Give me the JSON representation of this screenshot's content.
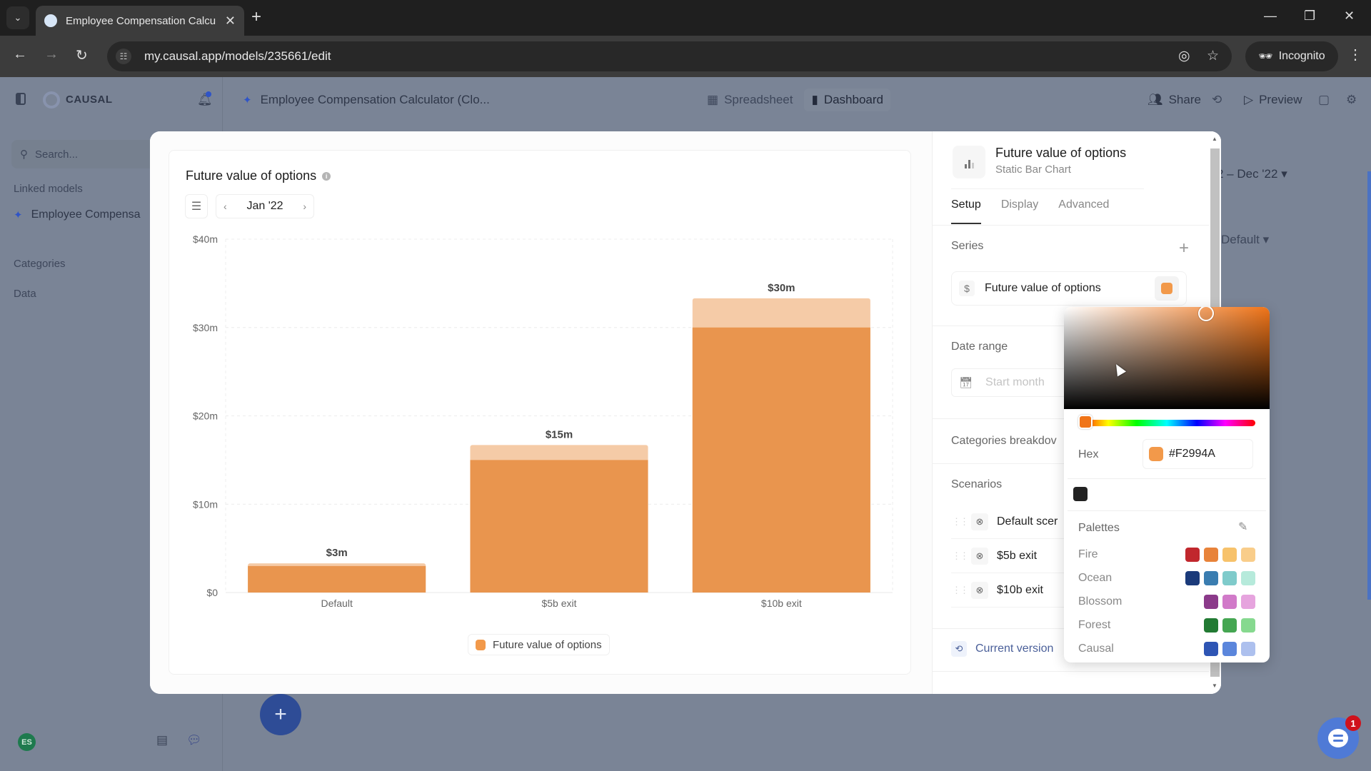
{
  "browser": {
    "tab_title": "Employee Compensation Calcu",
    "url": "my.causal.app/models/235661/edit",
    "profile_label": "Incognito"
  },
  "app": {
    "brand": "CAUSAL",
    "doc_title": "Employee Compensation Calculator (Clo...",
    "view_tabs": [
      {
        "label": "Spreadsheet",
        "active": false
      },
      {
        "label": "Dashboard",
        "active": true
      }
    ],
    "share_label": "Share",
    "preview_label": "Preview",
    "sidebar": {
      "search_placeholder": "Search...",
      "linked_models_label": "Linked models",
      "linked_model": "Employee Compensa",
      "categories_label": "Categories",
      "data_label": "Data",
      "avatar_initials": "ES"
    },
    "background": {
      "date_range": "2 – Dec '22",
      "scenario_select": "Default"
    },
    "chat_badge_count": "1"
  },
  "chart_widget": {
    "title": "Future value of options",
    "date_label": "Jan '22",
    "legend_label": "Future value of options"
  },
  "chart_data": {
    "type": "bar",
    "title": "Future value of options",
    "categories": [
      "Default",
      "$5b exit",
      "$10b exit"
    ],
    "series": [
      {
        "name": "Future value of options",
        "values": [
          3.3,
          16.7,
          33.3
        ],
        "color": "#F2994A"
      }
    ],
    "data_labels": [
      "$3m",
      "$15m",
      "$30m"
    ],
    "highlight_base_values": [
      3,
      15,
      30
    ],
    "ylim": [
      0,
      40
    ],
    "yticks": [
      0,
      10,
      20,
      30,
      40
    ],
    "ytick_labels": [
      "$0",
      "$10m",
      "$20m",
      "$30m",
      "$40m"
    ],
    "xlabel": "",
    "ylabel": "",
    "grid": true,
    "legend": "bottom-center"
  },
  "panel": {
    "title": "Future value of options",
    "subtitle": "Static Bar Chart",
    "tabs": [
      {
        "label": "Setup",
        "active": true
      },
      {
        "label": "Display",
        "active": false
      },
      {
        "label": "Advanced",
        "active": false
      }
    ],
    "series_label": "Series",
    "series_item": "Future value of options",
    "series_color": "#F2994A",
    "date_range_label": "Date range",
    "start_month_placeholder": "Start month",
    "categories_breakdown_label": "Categories breakdov",
    "scenarios_label": "Scenarios",
    "scenarios": [
      "Default scer",
      "$5b exit",
      "$10b exit"
    ],
    "current_version_label": "Current version"
  },
  "color_picker": {
    "hex_label": "Hex",
    "hex_value": "#F2994A",
    "hue_color": "#F07418",
    "recent_colors": [
      "#222222"
    ],
    "palettes_label": "Palettes",
    "palettes": [
      {
        "name": "Fire",
        "colors": [
          "#C1272D",
          "#E8833A",
          "#F7C26B",
          "#F9CD8A"
        ]
      },
      {
        "name": "Ocean",
        "colors": [
          "#1B3A7A",
          "#3A7DB0",
          "#7FCBCB",
          "#B6EADB"
        ]
      },
      {
        "name": "Blossom",
        "colors": [
          "#8B3A8A",
          "#D17AC9",
          "#E6A4DE"
        ]
      },
      {
        "name": "Forest",
        "colors": [
          "#227A33",
          "#45A652",
          "#86D98F"
        ]
      },
      {
        "name": "Causal",
        "colors": [
          "#2E55B4",
          "#5B86DC",
          "#ADC0EE"
        ]
      }
    ]
  }
}
